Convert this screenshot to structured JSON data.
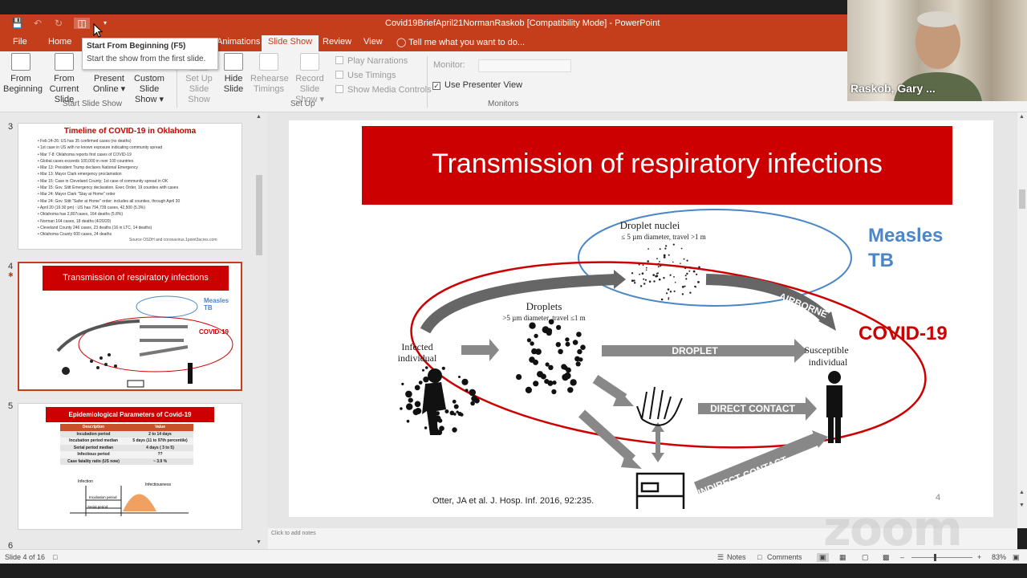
{
  "window": {
    "title": "Covid19BriefApril21NormanRaskob [Compatibility Mode] - PowerPoint"
  },
  "tabs": [
    "File",
    "Home",
    "Animations",
    "Slide Show",
    "Review",
    "View"
  ],
  "tell_me": "Tell me what you want to do...",
  "tooltip": {
    "title": "Start From Beginning (F5)",
    "desc": "Start the show from the first slide."
  },
  "ribbon": {
    "from_beginning": [
      "From",
      "Beginning"
    ],
    "from_current": [
      "From",
      "Current Slide"
    ],
    "present_online": [
      "Present",
      "Online ▾"
    ],
    "custom_show": [
      "Custom Slide",
      "Show ▾"
    ],
    "group_start": "Start Slide Show",
    "setup_show": [
      "Set Up",
      "Slide Show"
    ],
    "hide_slide": [
      "Hide",
      "Slide"
    ],
    "rehearse": [
      "Rehearse",
      "Timings"
    ],
    "record": [
      "Record Slide",
      "Show ▾"
    ],
    "play_narrations": "Play Narrations",
    "use_timings": "Use Timings",
    "show_media": "Show Media Controls",
    "group_setup": "Set Up",
    "monitor_label": "Monitor:",
    "presenter_view": "Use Presenter View",
    "group_monitors": "Monitors"
  },
  "webcam": {
    "name": "Raskob, Gary ..."
  },
  "thumbnails": {
    "n3": "3",
    "n4": "4",
    "n5": "5",
    "n6": "6",
    "t3_title": "Timeline of COVID-19 in Oklahoma",
    "t3_lines": [
      "• Feb 24-26: US has 35 confirmed cases (no deaths)",
      "• 1st case in US with no known exposure indicating community spread",
      "• Mar 7-8: Oklahoma reports first cases of COVID-19",
      "• Global cases exceeds 100,000 in over 100 countries",
      "• Mar 13: President Trump declares National Emergency",
      "• Mar 13: Mayor Clark emergency proclamation",
      "• Mar 15: Case in Cleveland County; 1st case of community spread in OK",
      "• Mar 15: Gov. Stitt Emergency declaration. Exec Order, 19 counties with cases",
      "• Mar 24: Mayor Clark \"Stay at Home\" order",
      "• Mar 24: Gov. Stitt \"Safer at Home\" order: includes all counties, through April 30",
      "• April 20 (16:30 pm) : US has 794,739 cases, 42,500 (5.3%)",
      "• Oklahoma has 2,807cases, 164 deaths (5.8%)",
      "• Norman 164 cases, 18 deaths (4/20/20)",
      "• Cleveland County 246 cases, 23 deaths (16 in LTC, 14 deaths)",
      "• Oklahoma County 600 cases, 24 deaths"
    ],
    "t3_source": "Source OSDH and coronavirus.1point3acres.com",
    "t4_title": "Transmission of respiratory infections",
    "t4_measles": "Measles",
    "t4_tb": "TB",
    "t4_covid": "COVID-19",
    "t5_title": "Epidemiological Parameters of Covid-19",
    "t5_head": [
      "Description",
      "Value"
    ],
    "t5_rows": [
      [
        "Incubation period",
        "2 to 14 days"
      ],
      [
        "Incubation period median",
        "5 days (11 to 97th percentile)"
      ],
      [
        "Serial period median",
        "4 days ( 3 to 5)"
      ],
      [
        "Infectious period",
        "??"
      ],
      [
        "Case fatality ratio (US now)",
        "~ 3.9 %"
      ]
    ],
    "t5_infection": "Infection",
    "t5_infectiousness": "Infectiousness",
    "t5_incubation": "Incubation period",
    "t5_serial": "Serial period"
  },
  "slide": {
    "title": "Transmission of respiratory infections",
    "droplet_nuclei": "Droplet nuclei",
    "droplet_nuclei_sub": "≤ 5 µm diameter, travel >1 m",
    "measles": "Measles",
    "tb": "TB",
    "covid": "COVID-19",
    "airborne": "AIRBORNE",
    "droplets": "Droplets",
    "droplets_sub": ">5 µm diameter, travel ≤1 m",
    "infected_1": "Infected",
    "infected_2": "individual",
    "susceptible_1": "Susceptible",
    "susceptible_2": "individual",
    "droplet": "DROPLET",
    "direct": "DIRECT CONTACT",
    "indirect": "INDIRECT CONTACT",
    "citation": "Otter, JA et al. J. Hosp. Inf. 2016, 92:235.",
    "page": "4"
  },
  "notes_placeholder": "Click to add notes",
  "status": {
    "slide_of": "Slide 4 of 16",
    "notes": "Notes",
    "comments": "Comments",
    "zoom": "83%"
  },
  "zoom_watermark": "zoom",
  "colors": {
    "ppt_red": "#c43e1c",
    "slide_red": "#cc0000",
    "measles_blue": "#4a86c8"
  }
}
